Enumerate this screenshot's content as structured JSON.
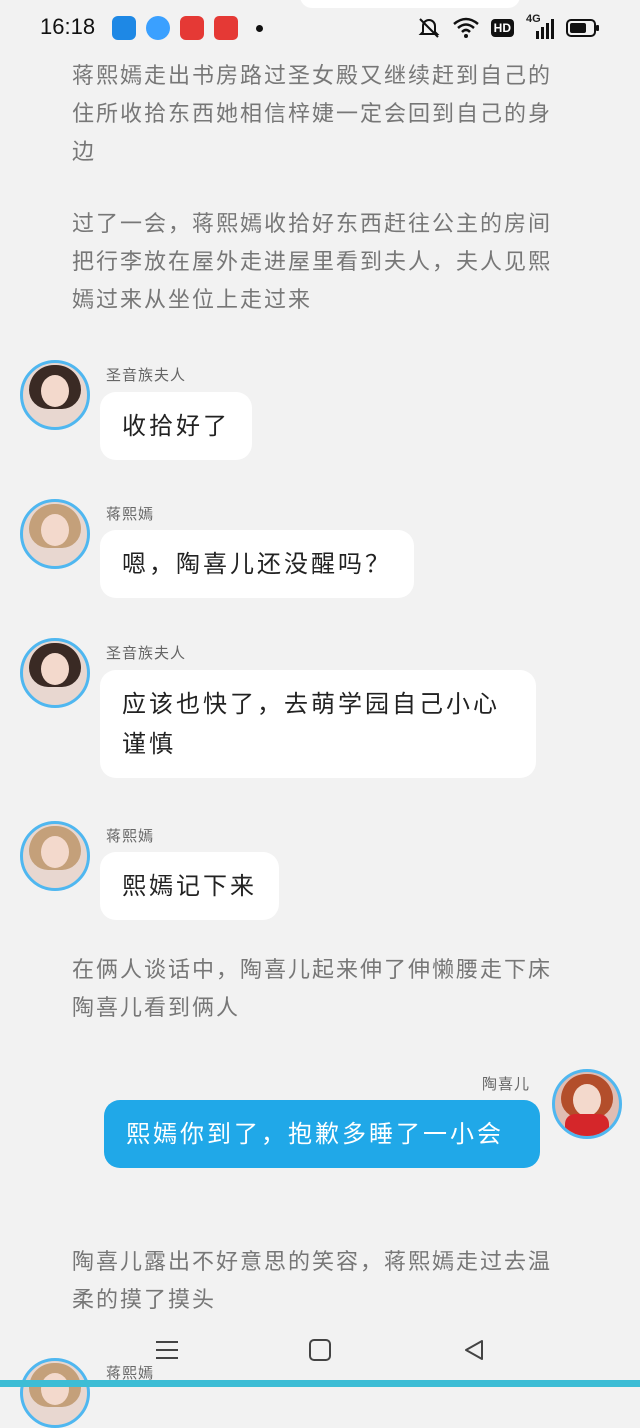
{
  "status_bar": {
    "time": "16:18",
    "icons": [
      "notification-app-icon",
      "browser-app-icon",
      "video-app-icon",
      "gift-app-icon",
      "mute-icon",
      "wifi-icon",
      "hd-icon",
      "signal-4g-icon",
      "battery-icon"
    ],
    "hd_label": "HD",
    "network_label": "4G"
  },
  "narration": [
    "蒋熙嫣走出书房路过圣女殿又继续赶到自己的住所收拾东西她相信梓婕一定会回到自己的身边",
    "过了一会，蒋熙嫣收拾好东西赶往公主的房间把行李放在屋外走进屋里看到夫人，夫人见熙嫣过来从坐位上走过来",
    "在俩人谈话中，陶喜儿起来伸了伸懒腰走下床陶喜儿看到俩人",
    "陶喜儿露出不好意思的笑容，蒋熙嫣走过去温柔的摸了摸头"
  ],
  "messages": [
    {
      "name": "圣音族夫人",
      "text": "收拾好了"
    },
    {
      "name": "蒋熙嫣",
      "text": "嗯，陶喜儿还没醒吗？"
    },
    {
      "name": "圣音族夫人",
      "text": "应该也快了，去萌学园自己小心谨慎"
    },
    {
      "name": "蒋熙嫣",
      "text": "熙嫣记下来"
    },
    {
      "name": "陶喜儿",
      "text": "熙嫣你到了，抱歉多睡了一小会"
    },
    {
      "name": "蒋熙嫣",
      "text": ""
    }
  ],
  "colors": {
    "background": "#f2f2f2",
    "bubble_left": "#ffffff",
    "bubble_right": "#20a8e8",
    "avatar_ring": "#4fb7f0",
    "narration_text": "#777777"
  },
  "nav": {
    "icons": [
      "menu-icon",
      "home-icon",
      "back-icon"
    ]
  }
}
